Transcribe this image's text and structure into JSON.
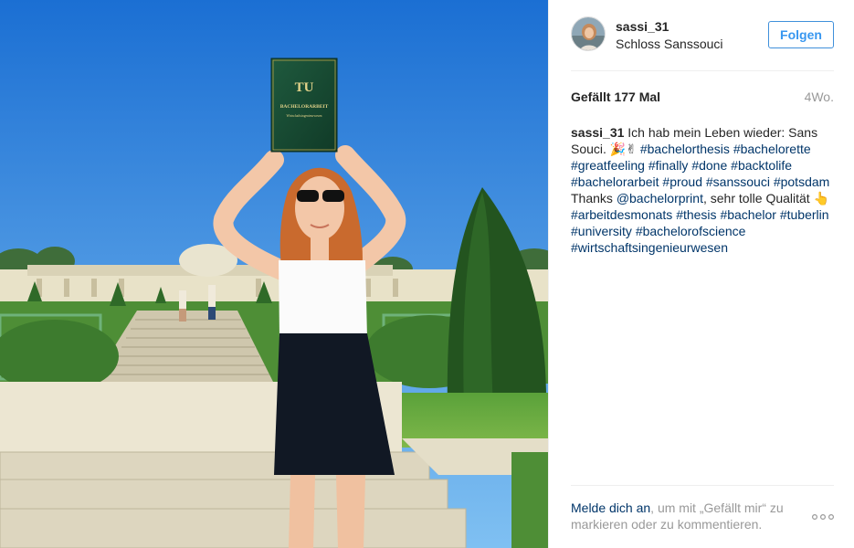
{
  "post": {
    "username": "sassi_31",
    "location": "Schloss Sanssouci",
    "follow_label": "Folgen",
    "likes": "Gefällt 177 Mal",
    "time_ago": "4Wo.",
    "caption": {
      "user": "sassi_31",
      "parts": [
        {
          "t": "text",
          "v": " Ich hab mein Leben wieder: Sans Souci. 🎉✌ "
        },
        {
          "t": "tag",
          "v": "#bachelorthesis"
        },
        {
          "t": "text",
          "v": " "
        },
        {
          "t": "tag",
          "v": "#bachelorette"
        },
        {
          "t": "text",
          "v": " "
        },
        {
          "t": "tag",
          "v": "#greatfeeling"
        },
        {
          "t": "text",
          "v": " "
        },
        {
          "t": "tag",
          "v": "#finally"
        },
        {
          "t": "text",
          "v": " "
        },
        {
          "t": "tag",
          "v": "#done"
        },
        {
          "t": "text",
          "v": " "
        },
        {
          "t": "tag",
          "v": "#backtolife"
        },
        {
          "t": "text",
          "v": " "
        },
        {
          "t": "tag",
          "v": "#bachelorarbeit"
        },
        {
          "t": "text",
          "v": " "
        },
        {
          "t": "tag",
          "v": "#proud"
        },
        {
          "t": "text",
          "v": " "
        },
        {
          "t": "tag",
          "v": "#sanssouci"
        },
        {
          "t": "text",
          "v": " "
        },
        {
          "t": "tag",
          "v": "#potsdam"
        },
        {
          "t": "text",
          "v": " Thanks "
        },
        {
          "t": "tag",
          "v": "@bachelorprint"
        },
        {
          "t": "text",
          "v": ", sehr tolle Qualität 👆 "
        },
        {
          "t": "tag",
          "v": "#arbeitdesmonats"
        },
        {
          "t": "text",
          "v": " "
        },
        {
          "t": "tag",
          "v": "#thesis"
        },
        {
          "t": "text",
          "v": " "
        },
        {
          "t": "tag",
          "v": "#bachelor"
        },
        {
          "t": "text",
          "v": " "
        },
        {
          "t": "tag",
          "v": "#tuberlin"
        },
        {
          "t": "text",
          "v": " "
        },
        {
          "t": "tag",
          "v": "#university"
        },
        {
          "t": "text",
          "v": " "
        },
        {
          "t": "tag",
          "v": "#bachelorofscience"
        },
        {
          "t": "text",
          "v": " "
        },
        {
          "t": "tag",
          "v": "#wirtschaftsingenieurwesen"
        }
      ]
    },
    "footer": {
      "login_link": "Melde dich an",
      "login_rest": ", um mit „Gefällt mir“ zu markieren oder zu kommentieren."
    },
    "book": {
      "logo": "TU",
      "title": "BACHELORARBEIT",
      "subtitle": "Wirtschaftsingenieurwesen"
    }
  },
  "colors": {
    "link": "#003569",
    "follow_blue": "#3897f0",
    "muted": "#999999",
    "text": "#262626"
  }
}
